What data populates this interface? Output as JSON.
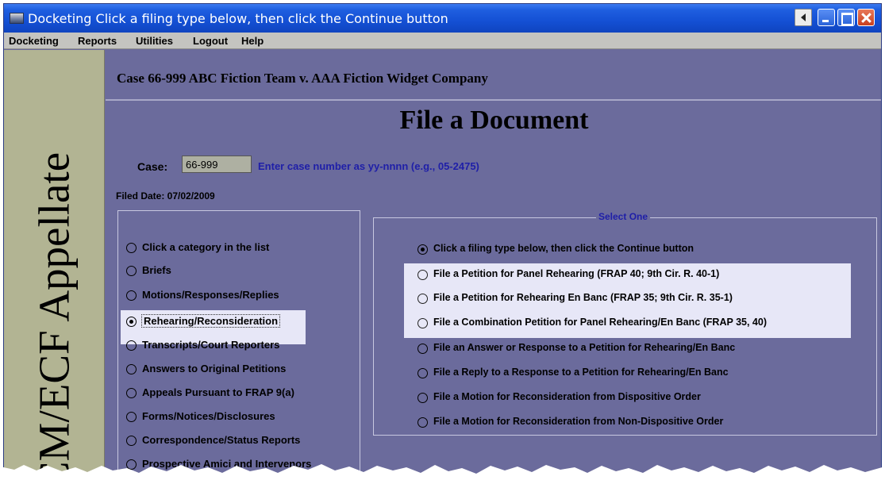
{
  "window": {
    "title": "Docketing Click a filing type below, then click the Continue button"
  },
  "menu": [
    "Docketing",
    "Reports",
    "Utilities",
    "Logout",
    "Help"
  ],
  "sidebar": {
    "text": "CM/ECF Appellate"
  },
  "case_header": "Case 66-999 ABC Fiction Team v. AAA Fiction Widget Company",
  "page_title": "File a Document",
  "case_field": {
    "label": "Case:",
    "value": "66-999",
    "hint": "Enter case number as yy-nnnn (e.g., 05-2475)"
  },
  "filed_date": "Filed Date: 07/02/2009",
  "categories": [
    "Click a category in the list",
    "Briefs",
    "Motions/Responses/Replies",
    "Rehearing/Reconsideration",
    "Transcripts/Court Reporters",
    "Answers to Original Petitions",
    "Appeals Pursuant to FRAP 9(a)",
    "Forms/Notices/Disclosures",
    "Correspondence/Status Reports",
    "Prospective Amici and Intervenors"
  ],
  "categories_selected": "Rehearing/Reconsideration",
  "select_one": {
    "legend": "Select One",
    "options": [
      "Click a filing type below, then click the Continue button",
      "File a Petition for Panel Rehearing (FRAP 40; 9th Cir. R. 40-1)",
      "File a Petition for Rehearing En Banc (FRAP 35; 9th Cir. R. 35-1)",
      "File a Combination Petition for Panel Rehearing/En Banc (FRAP 35, 40)",
      "File an Answer or Response to a Petition for Rehearing/En Banc",
      "File a Reply to a Response to a Petition for Rehearing/En Banc",
      "File a Motion for Reconsideration from Dispositive Order",
      "File a Motion for Reconsideration from Non-Dispositive Order"
    ],
    "selected": "Click a filing type below, then click the Continue button"
  },
  "colors": {
    "background": "#6b6b9c",
    "sidebar": "#b2b493",
    "hint": "#1f1fa8",
    "highlight": "#e7e7f7"
  },
  "icons": [
    "app-icon",
    "previous-icon",
    "minimize-icon",
    "maximize-icon",
    "close-icon"
  ]
}
